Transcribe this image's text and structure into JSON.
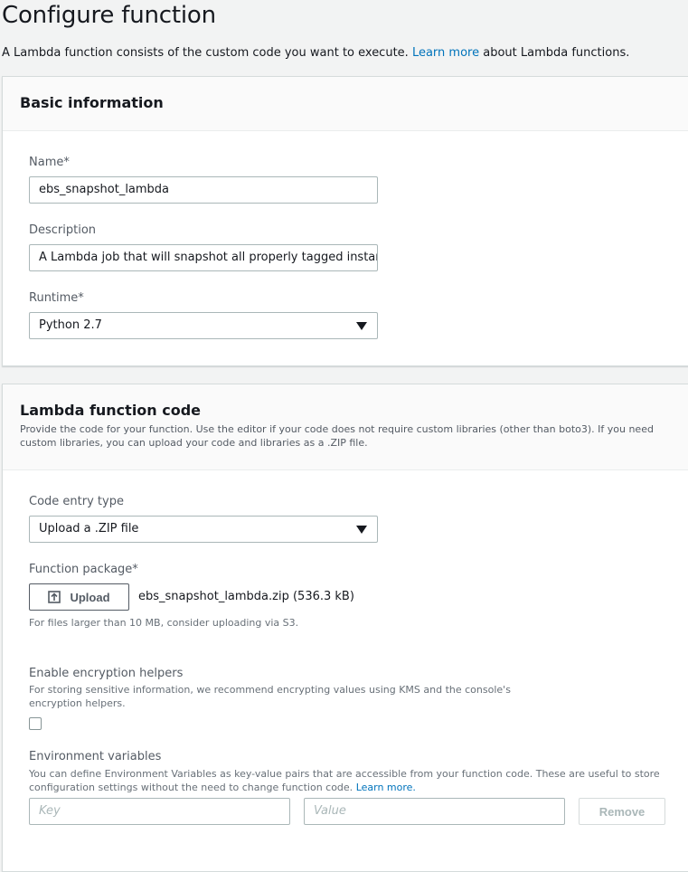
{
  "header": {
    "title": "Configure function",
    "intro_before": "A Lambda function consists of the custom code you want to execute.",
    "intro_link": "Learn more",
    "intro_after": "about Lambda functions."
  },
  "basic": {
    "title": "Basic information",
    "name_label": "Name*",
    "name_value": "ebs_snapshot_lambda",
    "description_label": "Description",
    "description_value": "A Lambda job that will snapshot all properly tagged instances",
    "runtime_label": "Runtime*",
    "runtime_value": "Python 2.7"
  },
  "code": {
    "title": "Lambda function code",
    "description": "Provide the code for your function. Use the editor if your code does not require custom libraries (other than boto3). If you need custom libraries, you can upload your code and libraries as a .ZIP file.",
    "entry_type_label": "Code entry type",
    "entry_type_value": "Upload a .ZIP file",
    "package_label": "Function package*",
    "upload_label": "Upload",
    "file_name": "ebs_snapshot_lambda.zip (536.3 kB)",
    "s3_hint": "For files larger than 10 MB, consider uploading via S3.",
    "encryption_label": "Enable encryption helpers",
    "encryption_help": "For storing sensitive information, we recommend encrypting values using KMS and the console's encryption helpers.",
    "encryption_checked": false,
    "env_label": "Environment variables",
    "env_help": "You can define Environment Variables as key-value pairs that are accessible from your function code. These are useful to store configuration settings without the need to change function code.",
    "env_help_link": "Learn more.",
    "key_placeholder": "Key",
    "value_placeholder": "Value",
    "remove_label": "Remove"
  },
  "icons": {
    "upload": "upload-icon",
    "dropdown": "caret-down-icon"
  },
  "colors": {
    "link": "#0073bb",
    "background": "#f2f3f3",
    "panel": "#ffffff"
  }
}
